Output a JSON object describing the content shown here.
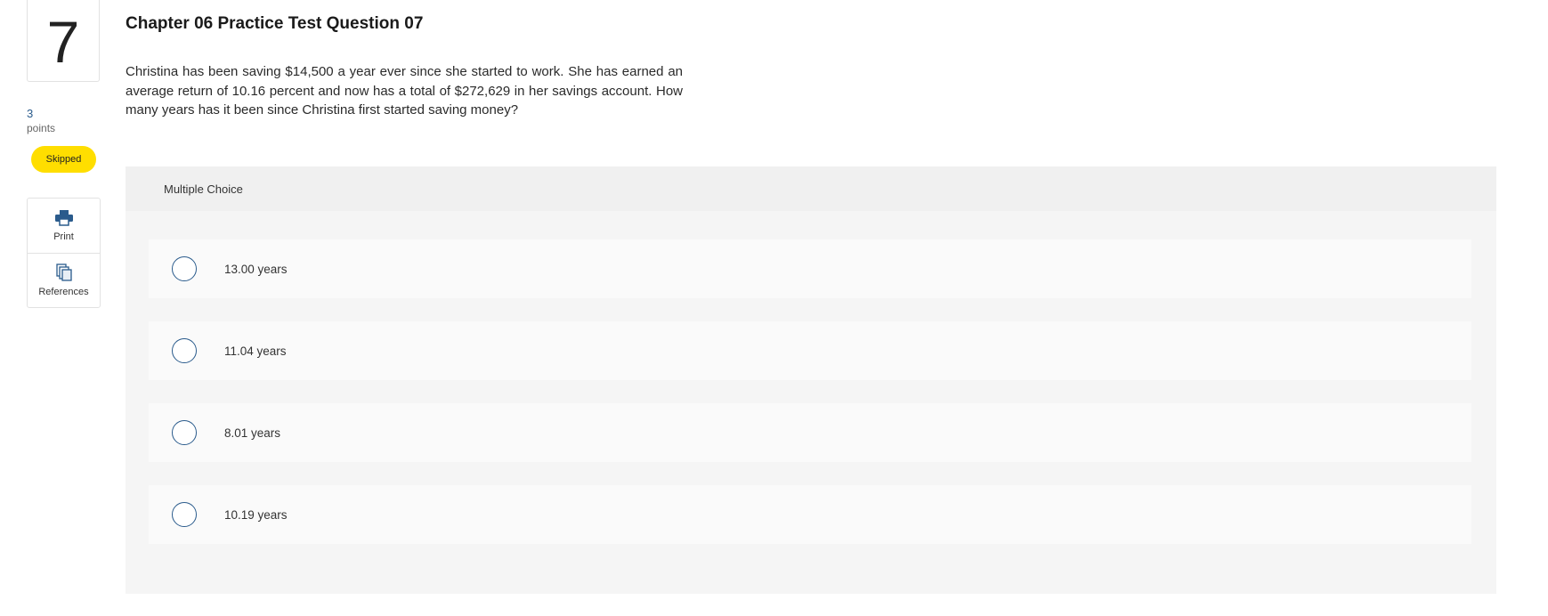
{
  "question": {
    "number": "7",
    "points_value": "3",
    "points_label": "points",
    "status_badge": "Skipped",
    "title": "Chapter 06 Practice Test Question 07",
    "prompt": "Christina has been saving $14,500 a year ever since she started to work. She has earned an average return of 10.16 percent and now has a total of $272,629 in her savings account. How many years has it been since Christina first started saving money?"
  },
  "tools": {
    "print_label": "Print",
    "references_label": "References",
    "print_icon": "printer-icon",
    "references_icon": "documents-icon"
  },
  "answer": {
    "type_label": "Multiple Choice",
    "options": [
      {
        "label": "13.00 years"
      },
      {
        "label": "11.04 years"
      },
      {
        "label": "8.01 years"
      },
      {
        "label": "10.19 years"
      }
    ]
  },
  "colors": {
    "accent": "#2a5b8c",
    "badge": "#ffde00",
    "panel": "#f5f5f5"
  }
}
